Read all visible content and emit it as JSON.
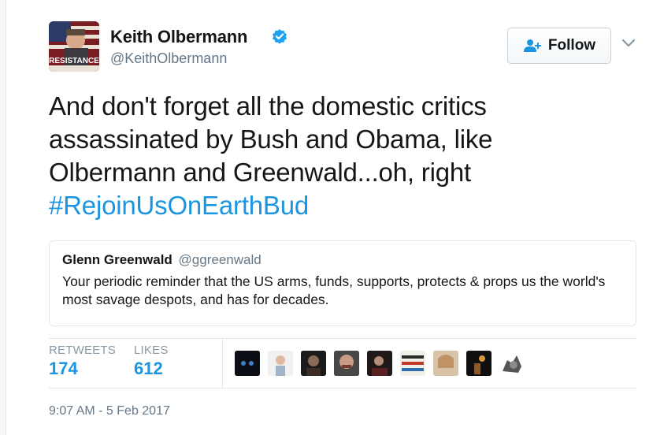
{
  "author": {
    "name": "Keith Olbermann",
    "handle": "@KeithOlbermann",
    "avatar_text": "RESISTANCE",
    "verified_icon": "verified-badge-icon"
  },
  "follow_button": {
    "label": "Follow",
    "icon": "follow-user-icon"
  },
  "menu_caret": "chevron-down-icon",
  "tweet": {
    "lines": [
      "And don't forget all the domestic critics",
      "assassinated by Bush and Obama, like",
      "Olbermann and Greenwald...oh, right"
    ],
    "hashtag": "#RejoinUsOnEarthBud"
  },
  "quoted_tweet": {
    "name": "Glenn Greenwald",
    "handle": "@ggreenwald",
    "text": "Your periodic reminder that the US arms, funds, supports, protects & props us the world's most savage despots, and has for decades."
  },
  "stats": {
    "retweets_label": "RETWEETS",
    "retweets_value": "174",
    "likes_label": "LIKES",
    "likes_value": "612"
  },
  "liker_avatars": [
    "avatar-1",
    "avatar-2",
    "avatar-3",
    "avatar-4",
    "avatar-5",
    "avatar-6",
    "avatar-7",
    "avatar-8",
    "avatar-9"
  ],
  "timestamp": "9:07 AM - 5 Feb 2017",
  "colors": {
    "link": "#1b95e0",
    "text": "#14171a",
    "muted": "#657786",
    "border": "#e1e8ed"
  }
}
